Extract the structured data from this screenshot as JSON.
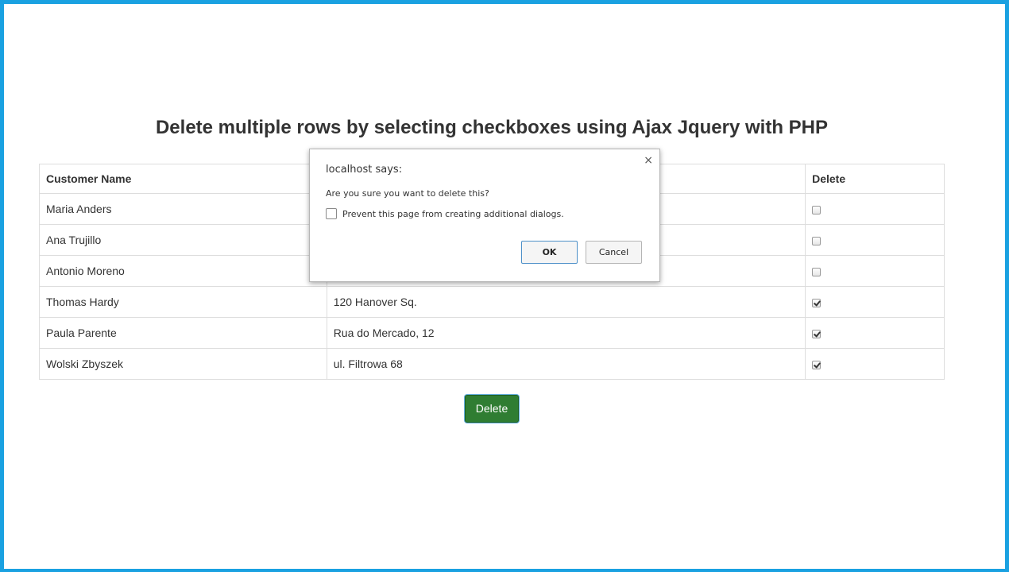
{
  "page": {
    "title": "Delete multiple rows by selecting checkboxes using Ajax Jquery with PHP",
    "delete_button": "Delete"
  },
  "table": {
    "headers": [
      "Customer Name",
      "",
      "Delete"
    ],
    "rows": [
      {
        "name": "Maria Anders",
        "address": "",
        "checked": false
      },
      {
        "name": "Ana Trujillo",
        "address": "",
        "checked": false
      },
      {
        "name": "Antonio Moreno",
        "address": "",
        "checked": false
      },
      {
        "name": "Thomas Hardy",
        "address": "120 Hanover Sq.",
        "checked": true
      },
      {
        "name": "Paula Parente",
        "address": "Rua do Mercado, 12",
        "checked": true
      },
      {
        "name": "Wolski Zbyszek",
        "address": "ul. Filtrowa 68",
        "checked": true
      }
    ]
  },
  "dialog": {
    "title": "localhost says:",
    "message": "Are you sure you want to delete this?",
    "prevent_label": "Prevent this page from creating additional dialogs.",
    "ok_label": "OK",
    "cancel_label": "Cancel",
    "close_glyph": "×"
  },
  "colors": {
    "frame": "#1aa1e1",
    "delete_button": "#2f7d32"
  }
}
